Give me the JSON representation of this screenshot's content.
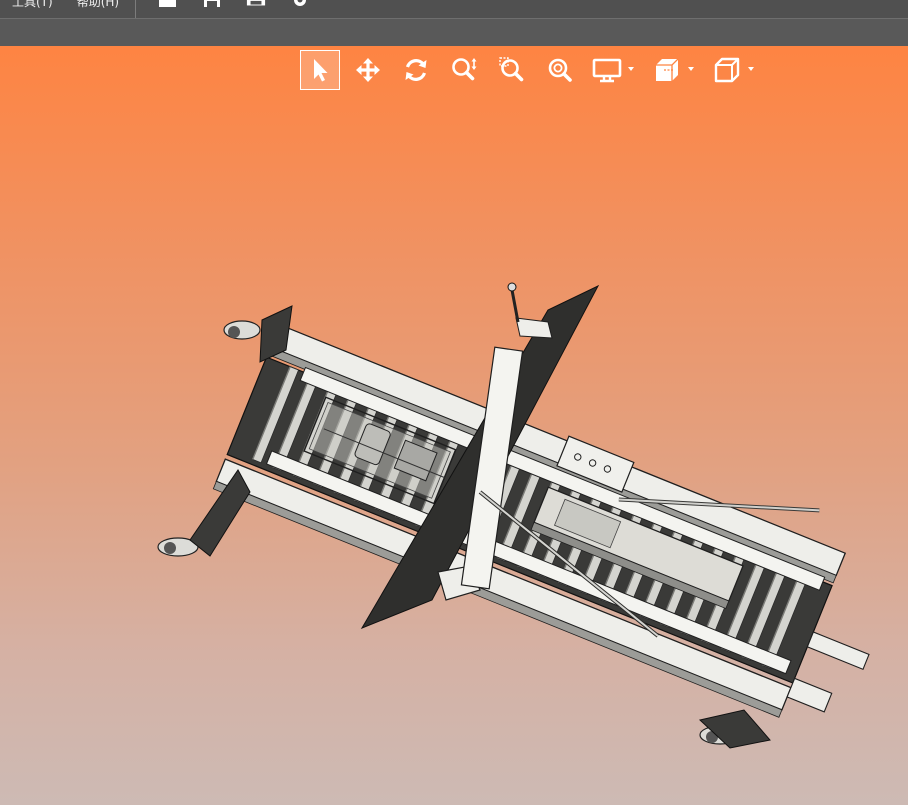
{
  "menubar": {
    "items": [
      {
        "label": "工具(T)",
        "icon": "tools"
      },
      {
        "label": "帮助(H)",
        "icon": "help"
      }
    ],
    "toolbar_icons": [
      "open-folder-icon",
      "save-icon",
      "print-icon",
      "settings-gear-icon"
    ]
  },
  "view_toolbar": {
    "tools": [
      {
        "name": "select-tool",
        "icon": "arrow-cursor-icon",
        "active": true
      },
      {
        "name": "pan-tool",
        "icon": "move-arrows-icon",
        "active": false
      },
      {
        "name": "rotate-tool",
        "icon": "rotate-icon",
        "active": false
      },
      {
        "name": "zoom-tool",
        "icon": "zoom-updown-icon",
        "active": false
      },
      {
        "name": "zoom-window-tool",
        "icon": "zoom-window-icon",
        "active": false
      },
      {
        "name": "zoom-fit-tool",
        "icon": "zoom-fit-icon",
        "active": false
      },
      {
        "name": "display-mode-dropdown",
        "icon": "monitor-icon",
        "dropdown": true
      },
      {
        "name": "section-view-dropdown",
        "icon": "section-cube-icon",
        "dropdown": true
      },
      {
        "name": "standard-views-dropdown",
        "icon": "cube-views-icon",
        "dropdown": true
      }
    ]
  },
  "viewport": {
    "background_top": "#fe8442",
    "background_bottom": "#cdbab4",
    "model": "conveyor-machine-3d-model"
  },
  "colors": {
    "menubar_bg": "#505050",
    "subbar_bg": "#595959",
    "icon_color": "#ffffff"
  }
}
